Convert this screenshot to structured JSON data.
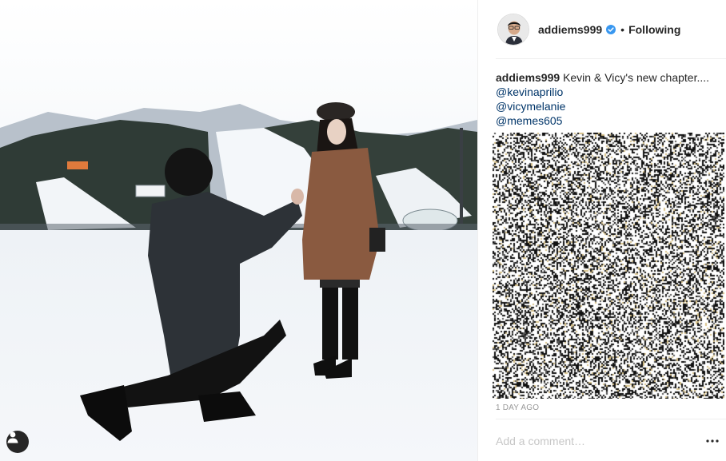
{
  "post": {
    "username": "addiems999",
    "follow_label": "Following",
    "separator": "•",
    "verified": true,
    "caption_text": "Kevin & Vicy's new chapter....",
    "mentions": [
      "@kevinaprilio",
      "@vicymelanie",
      "@memes605"
    ],
    "timestamp": "1 DAY AGO",
    "comment_placeholder": "Add a comment…"
  },
  "icons": {
    "tag": "user-tag-icon",
    "verified": "verified-badge-icon",
    "more": "more-options-icon"
  },
  "colors": {
    "verified_blue": "#3897f0",
    "link_blue": "#003569",
    "muted_gray": "#999999",
    "text_dark": "#262626"
  }
}
